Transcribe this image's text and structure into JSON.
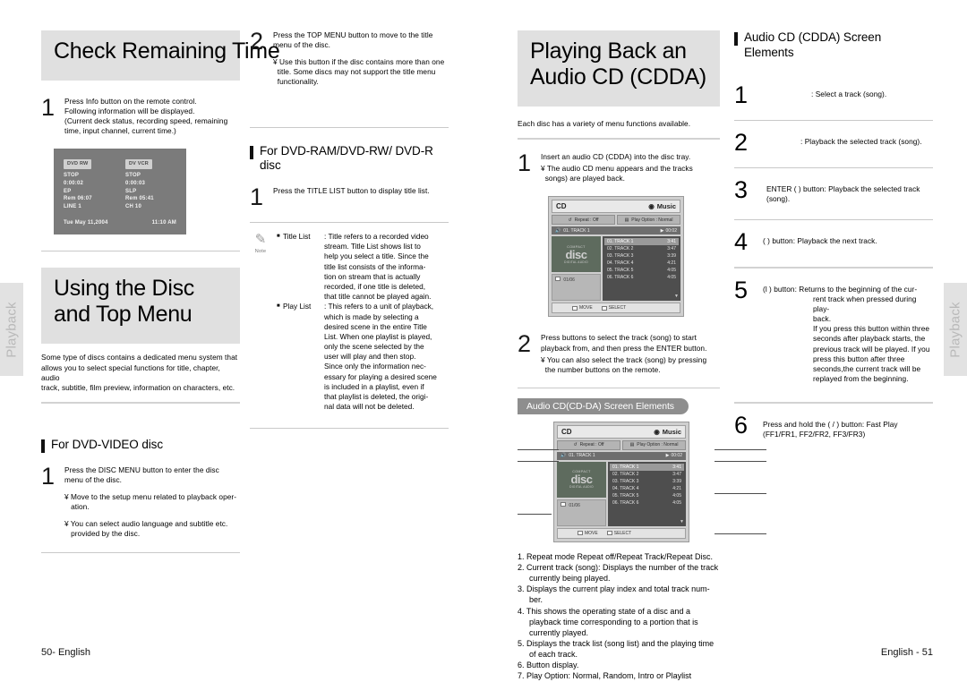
{
  "side_tabs": {
    "left": "Playback",
    "right": "Playback"
  },
  "footer": {
    "left": "50- English",
    "right": "English - 51"
  },
  "col1": {
    "heading": "Check Remaining Time",
    "step1": {
      "num": "1",
      "lines": [
        "Press Info button on the remote control.",
        "Following information will be displayed.",
        "(Current deck status, recording speed, remaining",
        " time, input channel, current time.)"
      ]
    },
    "osd": {
      "left": {
        "chip": "DVD RW",
        "lines": [
          "STOP",
          "0:00:02",
          "EP",
          "Rem 06:07",
          "LINE 1"
        ]
      },
      "right": {
        "chip": "DV VCR",
        "lines": [
          "STOP",
          "0:00:03",
          "SLP",
          "Rem 05:41",
          "CH 10"
        ]
      },
      "date": "Tue May 11,2004",
      "time": "11:10 AM"
    },
    "heading2": "Using the Disc and Top Menu",
    "intro": [
      "Some type of discs contains a dedicated menu system that",
      "allows you to select special functions for title, chapter, audio",
      "track, subtitle, film preview, information on characters, etc."
    ],
    "subhead": "For DVD-VIDEO disc",
    "step2": {
      "num": "1",
      "lines": [
        "Press the DISC MENU button to enter the disc",
        "menu of the disc."
      ],
      "bullets": [
        "¥ Move to the setup menu related to playback oper-\n   ation.",
        "¥ You can select audio language and subtitle etc.\n   provided by the disc."
      ]
    }
  },
  "col2": {
    "step2": {
      "num": "2",
      "lines": [
        "Press the TOP MENU button to move to the title",
        "menu of the disc."
      ],
      "bullet": "¥ Use this button if the disc contains more than one\n  title. Some discs may not support the title menu\n  functionality."
    },
    "subhead": "For DVD-RAM/DVD-RW/ DVD-R disc",
    "step1": {
      "num": "1",
      "text": "Press the TITLE LIST button to display title list."
    },
    "note": {
      "icon_label": "Note",
      "items": [
        {
          "label": "Title List",
          "lines": [
            ": Title refers to a recorded video",
            "stream. Title List shows list to",
            "help you select a title. Since the",
            "title list consists of the informa-",
            "tion on stream that is actually",
            "recorded, if one title is deleted,",
            "that title cannot be played again."
          ]
        },
        {
          "label": "Play List",
          "lines": [
            ": This refers to a unit of playback,",
            "which is made by selecting a",
            "desired scene in the entire Title",
            "List. When one playlist is played,",
            "only the scene selected by the",
            "user will play and then stop.",
            "Since only the information nec-",
            "essary for playing a desired scene",
            "is included in a playlist, even if",
            "that playlist is deleted, the origi-",
            "nal data will not be deleted."
          ]
        }
      ]
    }
  },
  "col3": {
    "heading": "Playing Back an Audio CD (CDDA)",
    "intro": "Each disc has a variety of menu functions available.",
    "step1": {
      "num": "1",
      "lines": [
        "Insert an audio CD (CDDA) into the disc tray."
      ],
      "bullets": [
        "¥ The audio CD menu appears and the tracks\n  songs) are played back."
      ]
    },
    "step2": {
      "num": "2",
      "lines": [
        "Press        buttons to select the track (song) to start",
        "playback from, and then press the ENTER button."
      ],
      "bullets": [
        "¥ You can also select the track (song) by pressing\n  the number buttons on the remote."
      ]
    },
    "ribbon": "Audio CD(CD-DA) Screen Elements",
    "speclist": [
      "1. Repeat mode Repeat off/Repeat Track/Repeat Disc.",
      "2. Current track (song): Displays the number of the track currently being played.",
      "3. Displays the current play index and total track num-ber.",
      "4. This shows the operating state of a disc and a playback time corresponding to a portion that is currently played.",
      "5. Displays the track list (song list) and the playing time of each track.",
      "6. Button display.",
      "7. Play Option: Normal, Random, Intro or Playlist"
    ]
  },
  "cdui": {
    "title": "CD",
    "music_label": "Music",
    "repeat_label": "Repeat : Off",
    "play_option_label": "Play Option : Normal",
    "now_playing": "01. TRACK 1",
    "elapsed": "00:02",
    "index": "01/06",
    "disc_logo_top": "COMPACT",
    "disc_logo_mid": "disc",
    "disc_logo_bot": "DIGITAL AUDIO",
    "tracks": [
      {
        "name": "01. TRACK 1",
        "time": "3:41"
      },
      {
        "name": "02. TRACK 2",
        "time": "3:47"
      },
      {
        "name": "03. TRACK 3",
        "time": "3:39"
      },
      {
        "name": "04. TRACK 4",
        "time": "4:21"
      },
      {
        "name": "05. TRACK 5",
        "time": "4:05"
      },
      {
        "name": "06. TRACK 6",
        "time": "4:05"
      }
    ],
    "btn_move": "MOVE",
    "btn_select": "SELECT"
  },
  "col4": {
    "subhead": "Audio CD (CDDA) Screen Elements",
    "items": [
      {
        "num": "1",
        "lines": [
          ": Select a track (song)."
        ]
      },
      {
        "num": "2",
        "lines": [
          ": Playback the selected track (song)."
        ]
      },
      {
        "num": "3",
        "lines": [
          "ENTER (       ) button: Playback the selected track (song)."
        ]
      },
      {
        "num": "4",
        "lines": [
          "(      ) button: Playback the next track."
        ]
      },
      {
        "num": "5",
        "lines": [
          "(l      ) button: Returns to the beginning of the cur-",
          "rent track when pressed during play-",
          "back.",
          "If you press this button within three",
          "seconds after playback starts, the",
          "previous track will be played. If you",
          "press this button after three",
          "seconds,the current track will be",
          "replayed from the beginning."
        ]
      },
      {
        "num": "6",
        "lines": [
          "Press and hold the (      /       ) button: Fast Play",
          "(FF1/FR1, FF2/FR2, FF3/FR3)"
        ]
      }
    ]
  },
  "colors": {
    "heading_bg": "#e0e0e0",
    "tab_bg": "#e2e2e2",
    "ribbon_bg": "#8e8e8e",
    "osd_bg": "#7b7b7b"
  }
}
